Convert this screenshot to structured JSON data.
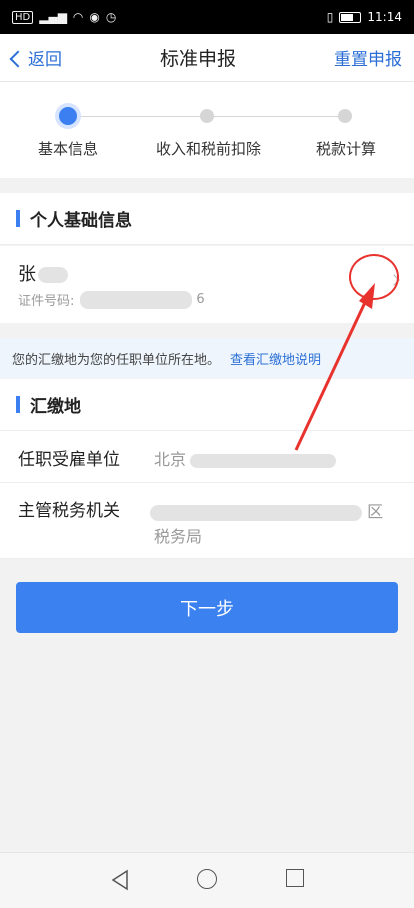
{
  "status_bar": {
    "left_icons": [
      "HD",
      "signal-icon",
      "wifi-icon",
      "eye-icon",
      "alarm-icon"
    ],
    "time": "11:14"
  },
  "nav": {
    "back_label": "返回",
    "title": "标准申报",
    "reset_label": "重置申报"
  },
  "stepper": {
    "steps": [
      {
        "label": "基本信息",
        "active": true
      },
      {
        "label": "收入和税前扣除",
        "active": false
      },
      {
        "label": "税款计算",
        "active": false
      }
    ]
  },
  "personal_section": {
    "title": "个人基础信息",
    "name_visible": "张",
    "id_label": "证件号码:",
    "id_suffix": "6"
  },
  "notice": {
    "text": "您的汇缴地为您的任职单位所在地。",
    "link": "查看汇缴地说明"
  },
  "remit_section": {
    "title": "汇缴地",
    "employer_label": "任职受雇单位",
    "employer_value_visible": "北京",
    "tax_office_label": "主管税务机关",
    "tax_office_line1_suffix": "区",
    "tax_office_line2": "税务局"
  },
  "actions": {
    "next_label": "下一步"
  },
  "colors": {
    "accent": "#3b82f0",
    "link": "#2b6fd6",
    "annotation": "#e8322e"
  }
}
